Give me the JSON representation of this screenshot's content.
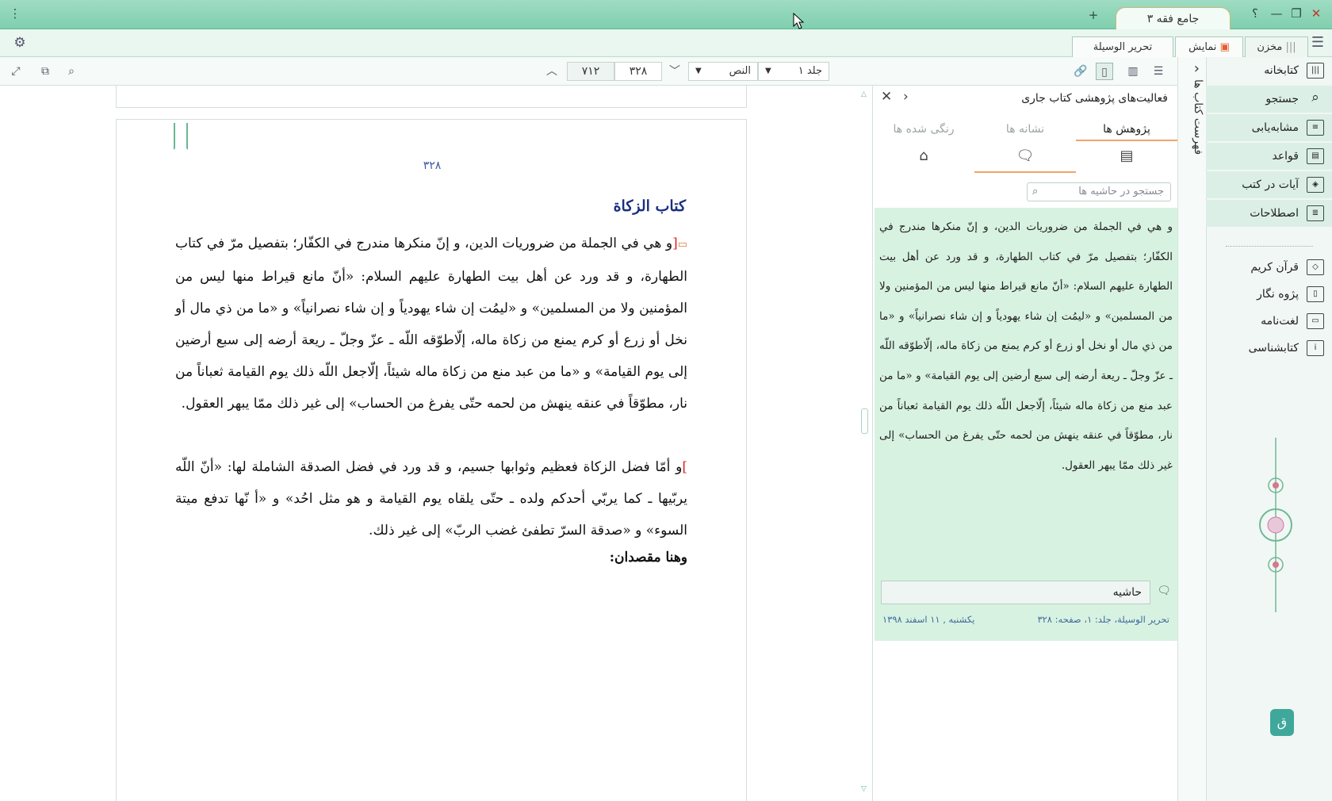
{
  "titlebar": {
    "app_tab": "جامع فقه ۳",
    "add": "+",
    "help": "؟",
    "minimize": "—",
    "restore": "❐",
    "close": "✕",
    "menu": "⋮"
  },
  "tabbar": {
    "tab_store": "مخزن",
    "tab_display": "نمایش",
    "doc_tab": "تحریر الوسیلة"
  },
  "toolbar": {
    "volume": "جلد ۱",
    "section": "النص",
    "page_current": "۳۲۸",
    "page_total": "۷۱۲"
  },
  "sidebar": {
    "vertical_label": "فهرست کتاب ها",
    "items": [
      {
        "label": "کتابخانه",
        "icon": "library-icon"
      },
      {
        "label": "جستجو",
        "icon": "search-icon"
      },
      {
        "label": "مشابه‌یابی",
        "icon": "similarity-icon"
      },
      {
        "label": "قواعد",
        "icon": "rules-icon"
      },
      {
        "label": "آیات در کتب",
        "icon": "verses-icon"
      },
      {
        "label": "اصطلاحات",
        "icon": "terms-icon"
      }
    ],
    "items2": [
      {
        "label": "قرآن کریم",
        "icon": "quran-icon"
      },
      {
        "label": "پژوه نگار",
        "icon": "notes-icon"
      },
      {
        "label": "لغت‌نامه",
        "icon": "dictionary-icon"
      },
      {
        "label": "کتابشناسی",
        "icon": "bibliography-icon"
      }
    ]
  },
  "panel": {
    "title": "فعالیت‌های پژوهشی کتاب جاری",
    "tabs": [
      "پژوهش ها",
      "نشانه ها",
      "رنگی شده ها"
    ],
    "search_placeholder": "جستجو در حاشیه ها",
    "note_text": "و هي في الجملة من ضروريات الدين، و إنّ منكرها مندرج في الكفّار؛ بتفصيل مرّ في كتاب الطهارة، و قد ورد عن أهل بيت الطهارة عليهم السلام: «أنّ مانع قيراط منها ليس من المؤمنين ولا من المسلمين» و «ليمُت إن شاء يهودياً و إن شاء نصرانياً» و «ما من ذي مال أو نخل أو زرع أو كرم يمنع من زكاة ماله، إلّاطوّقه اللّه ـ عزّ وجلّ ـ ريعة أرضه إلى سبع أرضين إلى يوم القيامة» و «ما من عبد منع من زكاة ماله شيئاً، إلّاجعل اللّه ذلك يوم القيامة ثعباناً من نار، مطوّقاً في عنقه ينهش من لحمه حتّى يفرغ من الحساب» إلى غير ذلك ممّا يبهر العقول.",
    "note_input": "حاشیه",
    "meta_source": "تحریر الوسیلة، جلد: ۱، صفحه: ۳۲۸",
    "meta_date": "یکشنبه , ۱۱ اسفند ۱۳۹۸"
  },
  "document": {
    "page_number": "۳۲۸",
    "heading": "كتاب الزكاة",
    "para1": "و هي في الجملة من ضروريات الدين، و إنّ منكرها مندرج في الكفّار؛ بتفصيل مرّ في كتاب الطهارة، و قد ورد عن أهل بيت الطهارة عليهم السلام: «أنّ مانع قيراط منها ليس من المؤمنين ولا من المسلمين» و «ليمُت إن شاء يهودياً و إن شاء نصرانياً» و «ما من ذي مال أو نخل أو زرع أو كرم يمنع من زكاة ماله، إلّاطوّقه اللّه ـ عزّ وجلّ ـ ريعة أرضه إلى سبع أرضين إلى يوم القيامة» و «ما من عبد منع من زكاة ماله شيئاً، إلّاجعل اللّه ذلك يوم القيامة ثعباناً من نار، مطوّقاً في عنقه ينهش من لحمه حتّى يفرغ من الحساب» إلى غير ذلك ممّا يبهر العقول.",
    "para2": "و أمّا فضل الزكاة فعظيم وثوابها جسيم، و قد ورد في فضل الصدقة الشاملة لها: «أنّ اللّه يربّيها ـ كما يربّي أحدكم ولده ـ حتّى يلقاه يوم القيامة و هو مثل احُد» و «أ نّها تدفع ميتة السوء» و «صدقة السرّ تطفئ غضب الربّ» إلى غير ذلك.",
    "subheading": "وهنا مقصدان:"
  },
  "colors": {
    "accent": "#7fcfae",
    "note_bg": "#d8f2e2",
    "heading": "#1a3080"
  }
}
